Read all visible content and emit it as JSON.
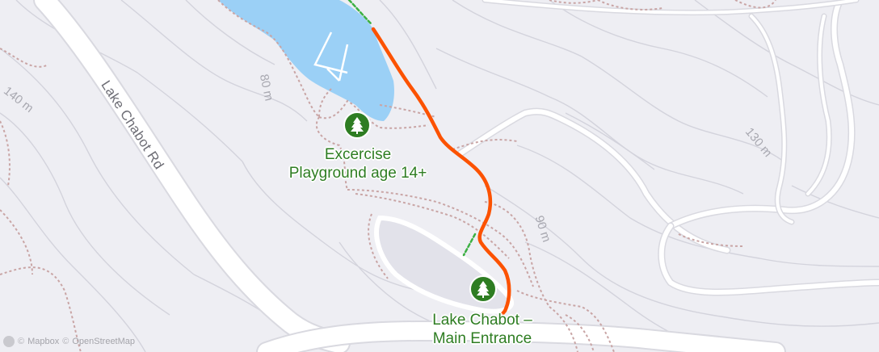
{
  "map": {
    "style": "outdoors-light",
    "colors": {
      "background": "#eeeef3",
      "water": "#9bd0f6",
      "road": "#ffffff",
      "road_edge": "#d9d9e0",
      "contour": "#d3d3dc",
      "trail": "#c9a5a5",
      "route": "#fc5200",
      "route_secondary": "#3cb043",
      "poi": "#2e7d22"
    },
    "road_labels": [
      {
        "id": "lake-chabot-rd",
        "text": "Lake Chabot Rd"
      }
    ],
    "contour_labels": [
      {
        "id": "c140",
        "text": "140 m"
      },
      {
        "id": "c80",
        "text": "80 m"
      },
      {
        "id": "c90",
        "text": "90 m"
      },
      {
        "id": "c130",
        "text": "130 m"
      }
    ],
    "pois": [
      {
        "id": "playground",
        "icon": "tree-icon",
        "lines": [
          "Excercise",
          "Playground age 14+"
        ]
      },
      {
        "id": "entrance",
        "icon": "tree-icon",
        "lines": [
          "Lake Chabot –",
          "Main Entrance"
        ]
      }
    ],
    "attribution": {
      "provider": "Mapbox",
      "source": "OpenStreetMap",
      "copyright": "©"
    }
  }
}
